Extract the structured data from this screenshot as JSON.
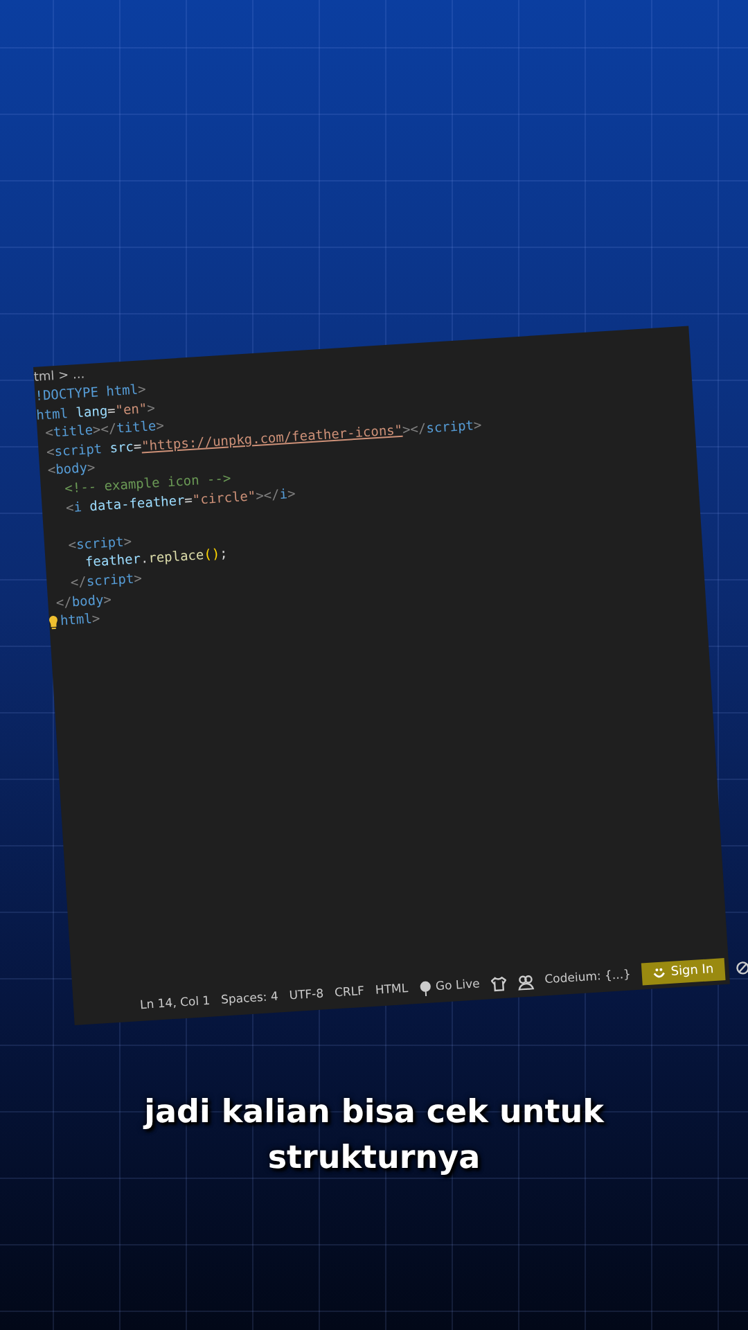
{
  "editor": {
    "breadcrumb": "tml > ...",
    "lines": [
      {
        "kind": "code",
        "tokens": [
          {
            "kind": "tag",
            "text": "!DOCTYPE"
          },
          {
            "kind": "tag",
            "text": " html"
          },
          {
            "kind": "punct",
            "text": ">"
          }
        ]
      },
      {
        "kind": "code",
        "tokens": [
          {
            "kind": "tag",
            "text": "html"
          },
          {
            "kind": "attr",
            "text": " lang"
          },
          {
            "kind": "text",
            "text": "="
          },
          {
            "kind": "string",
            "text": "\"en\""
          },
          {
            "kind": "punct",
            "text": ">"
          }
        ]
      },
      {
        "kind": "code",
        "tokens": [
          {
            "kind": "punct",
            "text": " <"
          },
          {
            "kind": "tag",
            "text": "title"
          },
          {
            "kind": "punct",
            "text": "></"
          },
          {
            "kind": "tag",
            "text": "title"
          },
          {
            "kind": "punct",
            "text": ">"
          }
        ]
      },
      {
        "kind": "code",
        "tokens": [
          {
            "kind": "punct",
            "text": " <"
          },
          {
            "kind": "tag",
            "text": "script"
          },
          {
            "kind": "attr",
            "text": " src"
          },
          {
            "kind": "text",
            "text": "="
          },
          {
            "kind": "link",
            "text": "\"https://unpkg.com/feather-icons\""
          },
          {
            "kind": "punct",
            "text": "></"
          },
          {
            "kind": "tag",
            "text": "script"
          },
          {
            "kind": "punct",
            "text": ">"
          }
        ]
      },
      {
        "kind": "code",
        "tokens": [
          {
            "kind": "punct",
            "text": " <"
          },
          {
            "kind": "tag",
            "text": "body"
          },
          {
            "kind": "punct",
            "text": ">"
          }
        ]
      },
      {
        "kind": "code",
        "tokens": [
          {
            "kind": "comment",
            "text": "   <!-- example icon -->"
          }
        ]
      },
      {
        "kind": "code",
        "tokens": [
          {
            "kind": "punct",
            "text": "   <"
          },
          {
            "kind": "tag",
            "text": "i"
          },
          {
            "kind": "attr",
            "text": " data-feather"
          },
          {
            "kind": "text",
            "text": "="
          },
          {
            "kind": "string",
            "text": "\"circle\""
          },
          {
            "kind": "punct",
            "text": "></"
          },
          {
            "kind": "tag",
            "text": "i"
          },
          {
            "kind": "punct",
            "text": ">"
          }
        ]
      },
      {
        "kind": "blank"
      },
      {
        "kind": "code",
        "tokens": [
          {
            "kind": "punct",
            "text": "   <"
          },
          {
            "kind": "tag",
            "text": "script"
          },
          {
            "kind": "punct",
            "text": ">"
          }
        ]
      },
      {
        "kind": "code",
        "tokens": [
          {
            "kind": "attr",
            "text": "     feather"
          },
          {
            "kind": "text",
            "text": "."
          },
          {
            "kind": "func",
            "text": "replace"
          },
          {
            "kind": "bracket",
            "text": "()"
          },
          {
            "kind": "text",
            "text": ";"
          }
        ]
      },
      {
        "kind": "code",
        "tokens": [
          {
            "kind": "punct",
            "text": "   </"
          },
          {
            "kind": "tag",
            "text": "script"
          },
          {
            "kind": "punct",
            "text": ">"
          }
        ]
      },
      {
        "kind": "code",
        "tokens": [
          {
            "kind": "punct",
            "text": " </"
          },
          {
            "kind": "tag",
            "text": "body"
          },
          {
            "kind": "punct",
            "text": ">"
          }
        ]
      },
      {
        "kind": "code",
        "tokens": [
          {
            "kind": "bulb"
          },
          {
            "kind": "tag",
            "text": "html"
          },
          {
            "kind": "punct",
            "text": ">"
          }
        ]
      }
    ]
  },
  "status_bar": [
    {
      "kind": "text",
      "text": "Ln 14, Col 1"
    },
    {
      "kind": "text",
      "text": "Spaces: 4"
    },
    {
      "kind": "text",
      "text": "UTF-8"
    },
    {
      "kind": "text",
      "text": "CRLF"
    },
    {
      "kind": "text",
      "text": "HTML"
    },
    {
      "kind": "golive",
      "text": "Go Live"
    },
    {
      "kind": "shirt"
    },
    {
      "kind": "people"
    },
    {
      "kind": "text",
      "text": "Codeium: {...}"
    },
    {
      "kind": "signin",
      "text": "Sign In"
    },
    {
      "kind": "nosign"
    }
  ],
  "caption": [
    "jadi kalian bisa cek untuk",
    "strukturnya"
  ]
}
